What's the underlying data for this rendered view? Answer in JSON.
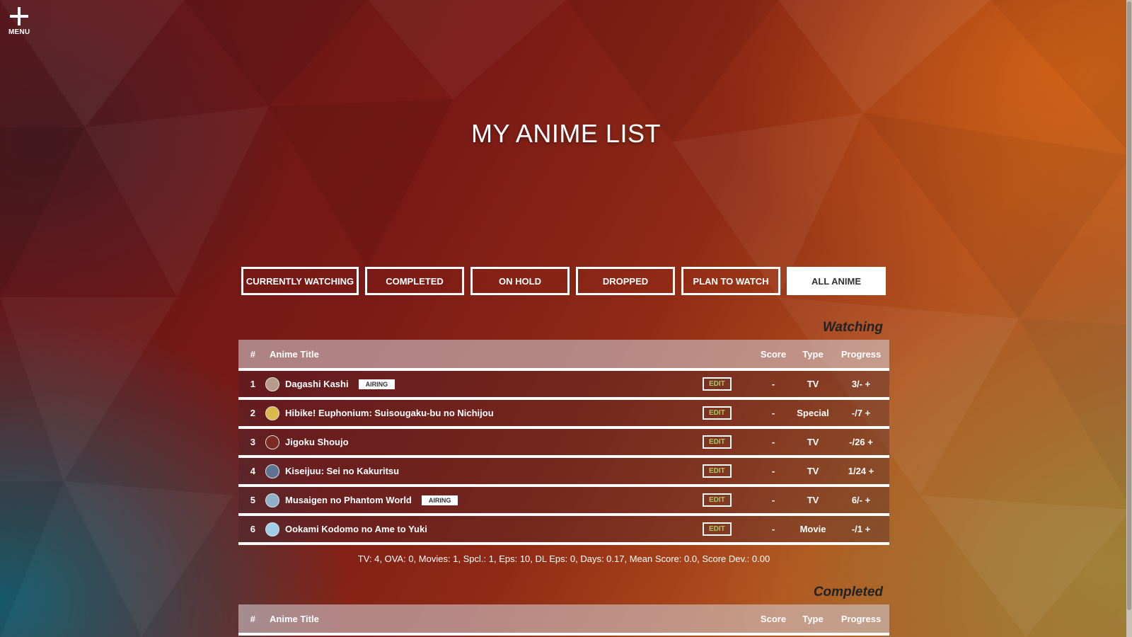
{
  "menu": {
    "label": "MENU"
  },
  "page_title": "MY ANIME LIST",
  "tabs": [
    {
      "label": "CURRENTLY WATCHING",
      "active": false
    },
    {
      "label": "COMPLETED",
      "active": false
    },
    {
      "label": "ON HOLD",
      "active": false
    },
    {
      "label": "DROPPED",
      "active": false
    },
    {
      "label": "PLAN TO WATCH",
      "active": false
    },
    {
      "label": "ALL ANIME",
      "active": true
    }
  ],
  "table_headers": {
    "num": "#",
    "title": "Anime Title",
    "score": "Score",
    "type": "Type",
    "progress": "Progress"
  },
  "watching": {
    "title": "Watching",
    "rows": [
      {
        "num": "1",
        "title": "Dagashi Kashi",
        "airing": "AIRING",
        "edit": "EDIT",
        "score": "-",
        "type": "TV",
        "progress": "3/- +"
      },
      {
        "num": "2",
        "title": "Hibike! Euphonium: Suisougaku-bu no Nichijou",
        "airing": "",
        "edit": "EDIT",
        "score": "-",
        "type": "Special",
        "progress": "-/7 +"
      },
      {
        "num": "3",
        "title": "Jigoku Shoujo",
        "airing": "",
        "edit": "EDIT",
        "score": "-",
        "type": "TV",
        "progress": "-/26 +"
      },
      {
        "num": "4",
        "title": "Kiseijuu: Sei no Kakuritsu",
        "airing": "",
        "edit": "EDIT",
        "score": "-",
        "type": "TV",
        "progress": "1/24 +"
      },
      {
        "num": "5",
        "title": "Musaigen no Phantom World",
        "airing": "AIRING",
        "edit": "EDIT",
        "score": "-",
        "type": "TV",
        "progress": "6/- +"
      },
      {
        "num": "6",
        "title": "Ookami Kodomo no Ame to Yuki",
        "airing": "",
        "edit": "EDIT",
        "score": "-",
        "type": "Movie",
        "progress": "-/1 +"
      }
    ],
    "stats": "TV: 4, OVA: 0, Movies: 1, Spcl.: 1, Eps: 10, DL Eps: 0, Days: 0.17, Mean Score: 0.0, Score Dev.: 0.00"
  },
  "completed": {
    "title": "Completed"
  },
  "colors": {
    "edit_text": "#9ccf63",
    "accent": "#ffffff"
  },
  "avatar_colors": [
    "#b89a8c",
    "#d9b94a",
    "#7a2b22",
    "#5d7391",
    "#8fb0c9",
    "#9fcfe6"
  ]
}
